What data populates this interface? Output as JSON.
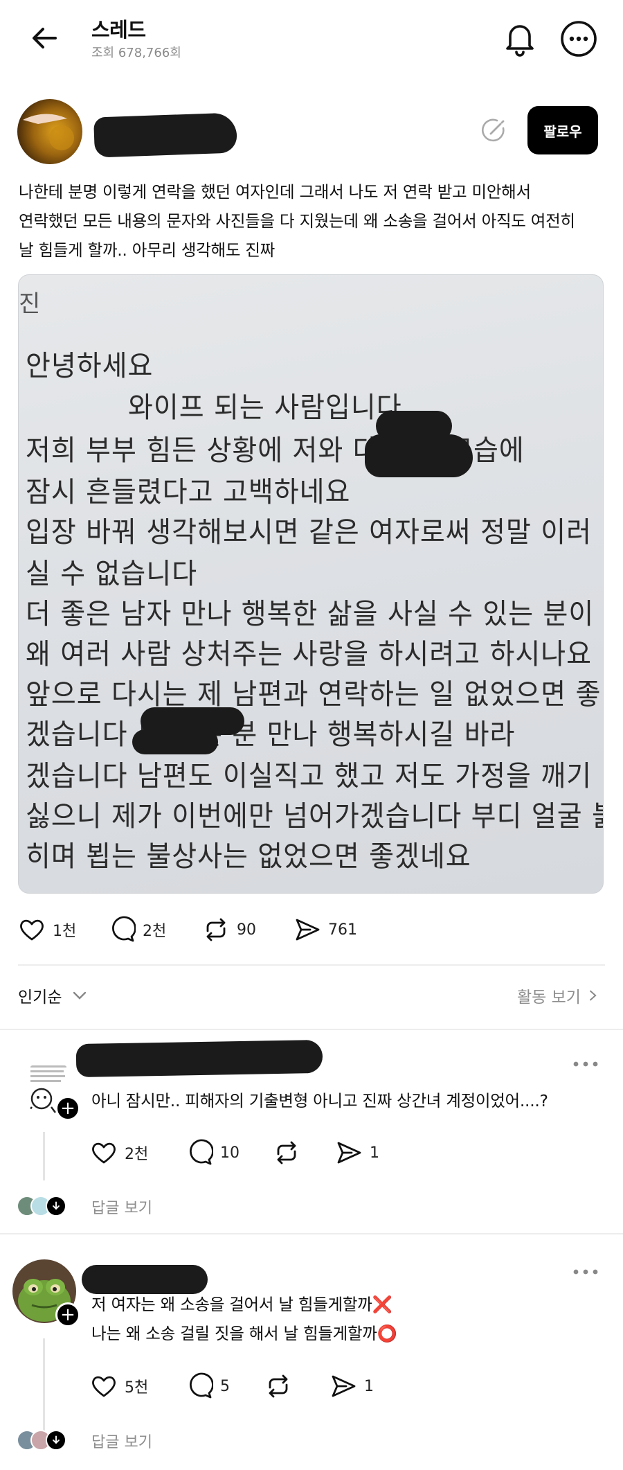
{
  "header": {
    "title": "스레드",
    "views": "조회 678,766회"
  },
  "post": {
    "follow_label": "팔로우",
    "text_lines": [
      "나한테 분명 이렇게 연락을 했던 여자인데 그래서 나도 저 연락 받고 미안해서",
      "연락했던 모든 내용의 문자와 사진들을 다 지웠는데 왜 소송을 걸어서 아직도 여전히",
      "날 힘들게 할까.. 아무리 생각해도 진짜"
    ],
    "photo": {
      "corner_text": "진",
      "lines": [
        "안녕하세요",
        "와이프 되는 사람입니다",
        "저희 부부 힘든 상황에 저와 다른 시 모습에",
        "잠시 흔들렸다고 고백하네요",
        "입장 바꿔 생각해보시면 같은 여자로써 정말 이러",
        "실 수 없습니다",
        "더 좋은 남자 만나 행복한 삶을 사실 수 있는 분이",
        "왜 여러 사람 상처주는 사랑을 하시려고 하시나요",
        "앞으로 다시는 제 남편과 연락하는 일 없었으면 좋",
        "겠습니다 도 좋은 분 만나 행복하시길 바라",
        "겠습니다 남편도 이실직고 했고 저도 가정을 깨기",
        "싫으니 제가 이번에만 넘어가겠습니다 부디 얼굴 붉",
        "히며 뵙는 불상사는 없었으면 좋겠네요"
      ]
    },
    "stats": {
      "likes": "1천",
      "comments": "2천",
      "reposts": "90",
      "shares": "761"
    }
  },
  "sort": {
    "label": "인기순",
    "activity_label": "활동 보기"
  },
  "comments": [
    {
      "text": "아니 잠시만.. 피해자의 기출변형 아니고 진짜 상간녀 계정이었어....?",
      "likes": "2천",
      "replies": "10",
      "reposts": "",
      "shares": "1",
      "view_replies": "답글 보기"
    },
    {
      "text_lines": [
        "저 여자는 왜 소송을 걸어서 날 힘들게할까❌",
        "나는 왜 소송 걸릴 짓을 해서 날 힘들게할까⭕"
      ],
      "likes": "5천",
      "replies": "5",
      "reposts": "",
      "shares": "1",
      "view_replies": "답글 보기"
    }
  ]
}
